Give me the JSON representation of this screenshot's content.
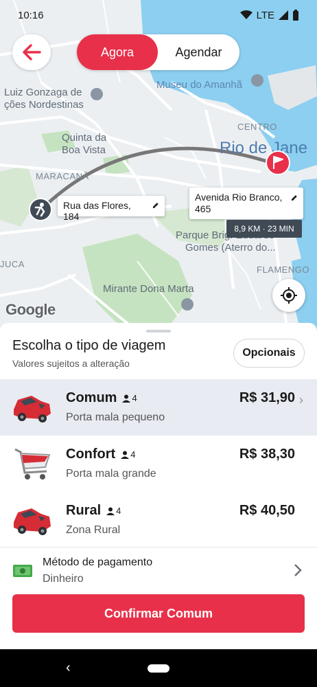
{
  "status": {
    "time": "10:16",
    "network": "LTE"
  },
  "toggle": {
    "active": "Agora",
    "inactive": "Agendar"
  },
  "map": {
    "labels": {
      "museu": "Museu do Amanhã",
      "luiz1": "Luiz Gonzaga de",
      "luiz2": "ções Nordestinas",
      "quinta1": "Quinta da",
      "quinta2": "Boa Vista",
      "centro": "CENTRO",
      "rio": "Rio de Jane",
      "maracana": "MARACANÃ",
      "parque1": "Parque Brig. Eduardo",
      "parque2": "Gomes (Aterro do...",
      "juca": "JUCA",
      "flamengo": "FLAMENGO",
      "mirante": "Mirante Dona Marta"
    },
    "origin": "Rua das Flores, 184",
    "destination": "Avenida Rio Branco, 465",
    "distance": "8,9 KM · 23 MIN",
    "attribution": "Google"
  },
  "sheet": {
    "title": "Escolha o tipo de viagem",
    "subtitle": "Valores sujeitos a alteração",
    "options_button": "Opcionais",
    "rides": [
      {
        "name": "Comum",
        "capacity": "4",
        "desc": "Porta mala pequeno",
        "price": "R$ 31,90",
        "selected": true
      },
      {
        "name": "Confort",
        "capacity": "4",
        "desc": "Porta mala grande",
        "price": "R$ 38,30",
        "selected": false
      },
      {
        "name": "Rural",
        "capacity": "4",
        "desc": "Zona Rural",
        "price": "R$ 40,50",
        "selected": false
      }
    ],
    "payment": {
      "label": "Método de pagamento",
      "value": "Dinheiro"
    },
    "confirm": "Confirmar Comum"
  },
  "colors": {
    "accent": "#e8304a",
    "water": "#8ccff0",
    "park": "#c5e3c0",
    "selected_row": "#e9ebf2"
  }
}
